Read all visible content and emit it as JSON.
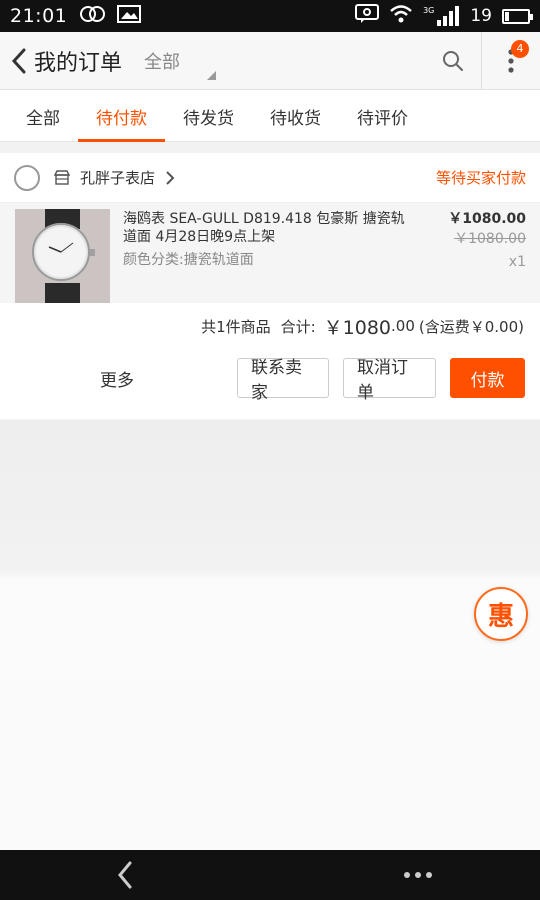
{
  "status_bar": {
    "time": "21:01",
    "battery_level": "19",
    "network": "3G",
    "left_icons": [
      "circles-icon",
      "image-icon"
    ],
    "right_icons": [
      "message-icon",
      "wifi-icon",
      "signal-icon",
      "battery-icon"
    ]
  },
  "header": {
    "title": "我的订单",
    "filter_label": "全部",
    "notification_count": "4"
  },
  "tabs": [
    {
      "label": "全部",
      "active": false
    },
    {
      "label": "待付款",
      "active": true
    },
    {
      "label": "待发货",
      "active": false
    },
    {
      "label": "待收货",
      "active": false
    },
    {
      "label": "待评价",
      "active": false
    }
  ],
  "order": {
    "shop_name": "孔胖子表店",
    "status": "等待买家付款",
    "item": {
      "title": "海鸥表 SEA-GULL D819.418 包豪斯 搪瓷轨道面 4月28日晚9点上架",
      "sku": "颜色分类:搪瓷轨道面",
      "price": "￥1080.00",
      "original_price": "￥1080.00",
      "quantity": "x1"
    },
    "summary": {
      "count_text": "共1件商品",
      "total_label": "合计:",
      "total_amount": "￥1080",
      "total_cents": ".00",
      "shipping_text": "(含运费￥0.00)"
    },
    "actions": {
      "more": "更多",
      "contact": "联系卖家",
      "cancel": "取消订单",
      "pay": "付款"
    }
  },
  "floating_button": {
    "label": "惠"
  },
  "colors": {
    "accent": "#ff5000",
    "status_bar": "#111111"
  }
}
